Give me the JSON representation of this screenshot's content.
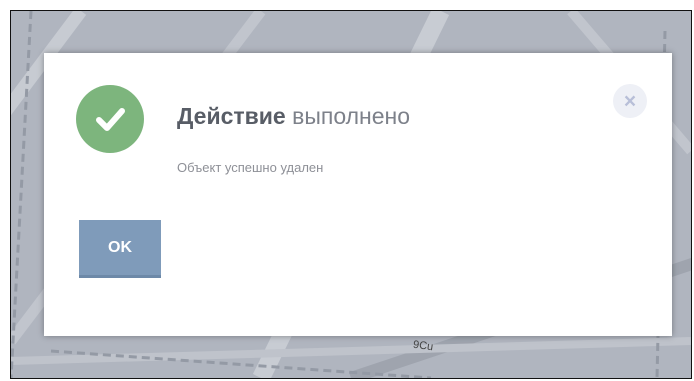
{
  "dialog": {
    "title_bold": "Действие",
    "title_rest": "выполнено",
    "message": "Объект успешно удален",
    "ok_label": "OK",
    "close_symbol": "×",
    "status_icon": "check-circle-icon",
    "close_icon": "close-icon"
  },
  "map": {
    "label": "9Cu"
  },
  "colors": {
    "success": "#7db57d",
    "button": "#7f9bba",
    "overlay": "#aeb3bd"
  }
}
